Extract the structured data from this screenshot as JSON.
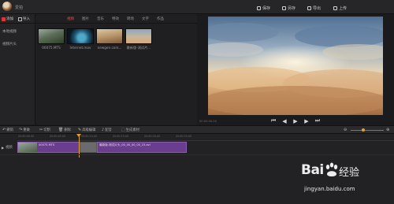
{
  "app": {
    "title": "爱拍"
  },
  "titlebar": {
    "buttons": [
      {
        "label": "保存",
        "icon": "save-icon"
      },
      {
        "label": "另存",
        "icon": "save-as-icon"
      },
      {
        "label": "导出",
        "icon": "export-icon"
      },
      {
        "label": "上传",
        "icon": "upload-icon"
      }
    ]
  },
  "left_panel": {
    "tabs": [
      {
        "label": "添加",
        "icon": "add-media-icon",
        "color": "#d43a3a"
      },
      {
        "label": "导入",
        "icon": "import-icon"
      }
    ],
    "categories": [
      "本地视频",
      "视频片头"
    ]
  },
  "media_tabs": [
    {
      "label": "视频",
      "active": true
    },
    {
      "label": "图片",
      "active": false
    },
    {
      "label": "音乐",
      "active": false
    },
    {
      "label": "特效",
      "active": false
    },
    {
      "label": "转场",
      "active": false
    },
    {
      "label": "文字",
      "active": false
    },
    {
      "label": "作品",
      "active": false
    }
  ],
  "media_items": [
    {
      "name": "00075.MTS",
      "thumb": "aerial-forest"
    },
    {
      "name": "Internet.mov",
      "thumb": "globe"
    },
    {
      "name": "newgen.com...",
      "thumb": "desert"
    },
    {
      "name": "最新版-测试片...",
      "thumb": "sky-clouds"
    }
  ],
  "preview": {
    "time": "00:00:00.00",
    "controls": [
      {
        "name": "prev",
        "glyph": "⏮"
      },
      {
        "name": "step-back",
        "glyph": "◀"
      },
      {
        "name": "play",
        "glyph": "▶"
      },
      {
        "name": "step-forward",
        "glyph": "▶"
      },
      {
        "name": "next",
        "glyph": "⏭"
      }
    ]
  },
  "toolbar": {
    "items": [
      {
        "label": "撤销",
        "icon": "undo-icon",
        "glyph": "↶"
      },
      {
        "label": "重做",
        "icon": "redo-icon",
        "glyph": "↷"
      },
      {
        "label": "切割",
        "icon": "cut-icon",
        "glyph": "✂"
      },
      {
        "label": "删除",
        "icon": "delete-icon",
        "glyph": "🗑"
      },
      {
        "label": "高级编辑",
        "icon": "edit-icon",
        "glyph": "✎"
      },
      {
        "label": "配音",
        "icon": "voiceover-icon",
        "glyph": "♪"
      },
      {
        "label": "生成素材",
        "icon": "generate-icon",
        "glyph": "⬚"
      }
    ]
  },
  "timeline": {
    "ruler_ticks": [
      "00:00:00.00",
      "00:00:05.00",
      "00:00:10.00",
      "00:00:15.00",
      "00:00:20.00",
      "00:00:25.00"
    ],
    "track_label": "视频",
    "clips": [
      {
        "name": "00075.MTS"
      },
      {
        "name": "最新版-测试片头_00_00_00_00_15.avi"
      }
    ],
    "zoom_level": 0.38
  },
  "watermark": {
    "brand": "Bai",
    "brand_cn": "经验",
    "url": "jingyan.baidu.com"
  }
}
